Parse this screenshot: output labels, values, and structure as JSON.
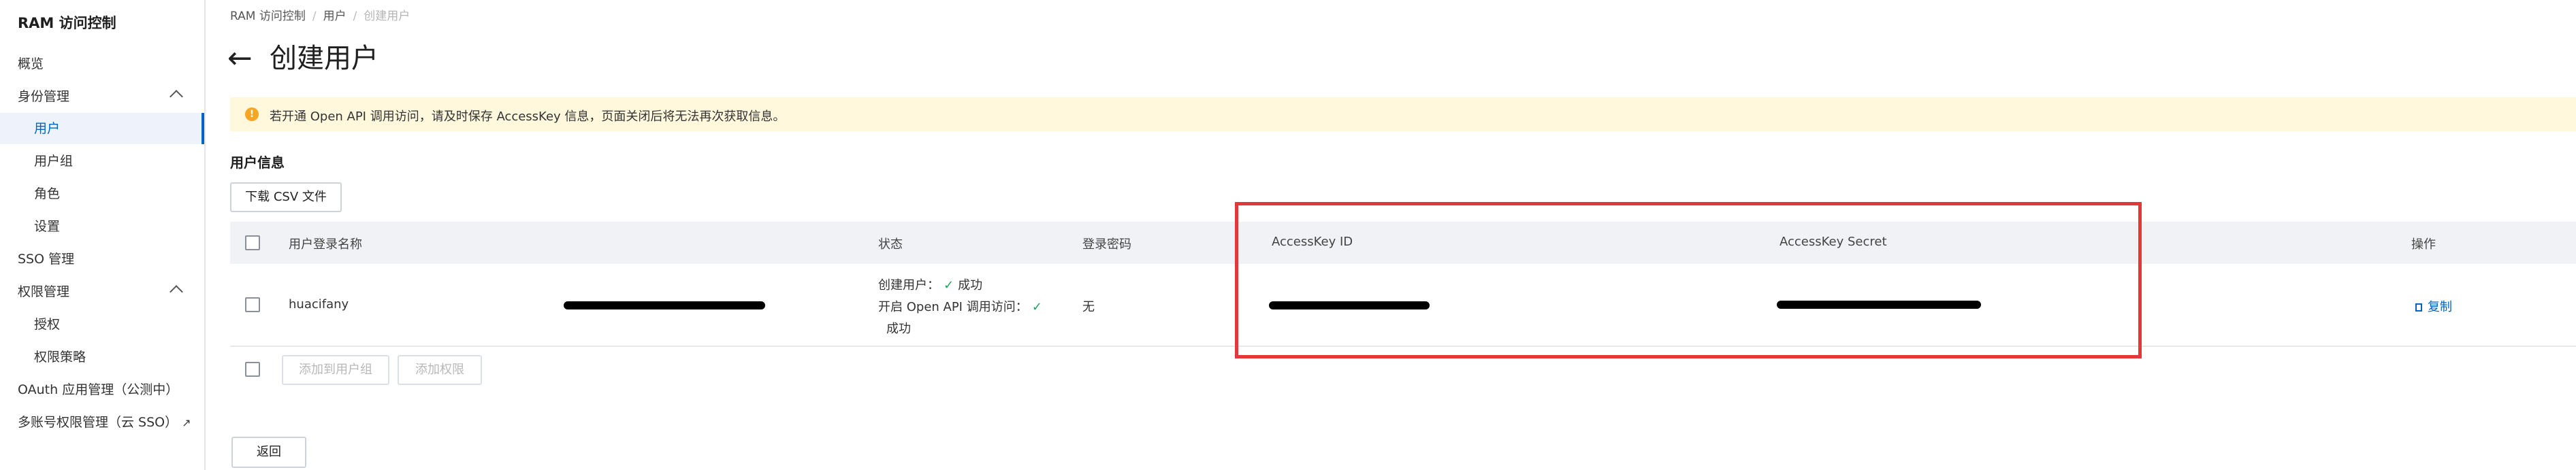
{
  "sidebar": {
    "title": "RAM 访问控制",
    "items": [
      {
        "label": "概览"
      },
      {
        "label": "身份管理"
      },
      {
        "label": "用户"
      },
      {
        "label": "用户组"
      },
      {
        "label": "角色"
      },
      {
        "label": "设置"
      },
      {
        "label": "SSO 管理"
      },
      {
        "label": "权限管理"
      },
      {
        "label": "授权"
      },
      {
        "label": "权限策略"
      },
      {
        "label": "OAuth 应用管理（公测中）"
      },
      {
        "label": "多账号权限管理（云 SSO）"
      }
    ]
  },
  "breadcrumb": [
    "RAM 访问控制",
    "用户",
    "创建用户"
  ],
  "page_title": "创建用户",
  "notice": "若开通 Open API 调用访问，请及时保存 AccessKey 信息，页面关闭后将无法再次获取信息。",
  "section_title": "用户信息",
  "download_csv_label": "下载 CSV 文件",
  "table": {
    "headers": {
      "login_name": "用户登录名称",
      "status": "状态",
      "password": "登录密码",
      "ak_id": "AccessKey ID",
      "ak_secret": "AccessKey Secret",
      "actions": "操作"
    },
    "row": {
      "login_name_prefix": "huacifany",
      "status_create": "创建用户：",
      "status_create_result": "成功",
      "status_api": "开启 Open API 调用访问：",
      "status_api_result": "成功",
      "password": "无",
      "copy_label": "复制"
    }
  },
  "footer_actions": {
    "add_to_group": "添加到用户组",
    "add_permission": "添加权限"
  },
  "back_label": "返回",
  "colors": {
    "accent": "#0064c8",
    "highlight": "#e3373a",
    "notice_bg": "#fff8dc",
    "success": "#1fa35a"
  }
}
